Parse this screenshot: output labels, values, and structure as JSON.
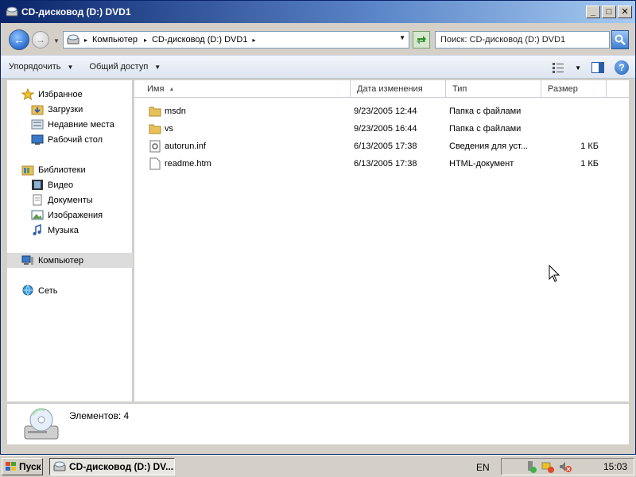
{
  "window": {
    "title": "CD-дисковод (D:) DVD1",
    "btn_min": "_",
    "btn_max": "□",
    "btn_close": "✕"
  },
  "address": {
    "crumbs": [
      "Компьютер",
      "CD-дисковод (D:) DVD1"
    ]
  },
  "search": {
    "placeholder": "Поиск: CD-дисковод (D:) DVD1"
  },
  "commandbar": {
    "organize": "Упорядочить",
    "share": "Общий доступ"
  },
  "navpane": {
    "favorites": "Избранное",
    "favorites_items": [
      "Загрузки",
      "Недавние места",
      "Рабочий стол"
    ],
    "libraries": "Библиотеки",
    "libraries_items": [
      "Видео",
      "Документы",
      "Изображения",
      "Музыка"
    ],
    "computer": "Компьютер",
    "network": "Сеть"
  },
  "filelist": {
    "columns": {
      "name": "Имя",
      "date": "Дата изменения",
      "type": "Тип",
      "size": "Размер"
    },
    "rows": [
      {
        "name": "msdn",
        "date": "9/23/2005 12:44",
        "type": "Папка с файлами",
        "size": "",
        "icon": "folder-icon"
      },
      {
        "name": "vs",
        "date": "9/23/2005 16:44",
        "type": "Папка с файлами",
        "size": "",
        "icon": "folder-icon"
      },
      {
        "name": "autorun.inf",
        "date": "6/13/2005 17:38",
        "type": "Сведения для уст...",
        "size": "1 КБ",
        "icon": "settings-file-icon"
      },
      {
        "name": "readme.htm",
        "date": "6/13/2005 17:38",
        "type": "HTML-документ",
        "size": "1 КБ",
        "icon": "document-icon"
      }
    ]
  },
  "details": {
    "count_text": "Элементов: 4"
  },
  "taskbar": {
    "start": "Пуск",
    "task": "CD-дисковод (D:) DV...",
    "lang": "EN",
    "clock": "15:03"
  },
  "colors": {
    "titlebar_start": "#0a246a",
    "titlebar_end": "#a6caf0",
    "folder": "#e8c15a",
    "selection": "#dcdcdc"
  }
}
